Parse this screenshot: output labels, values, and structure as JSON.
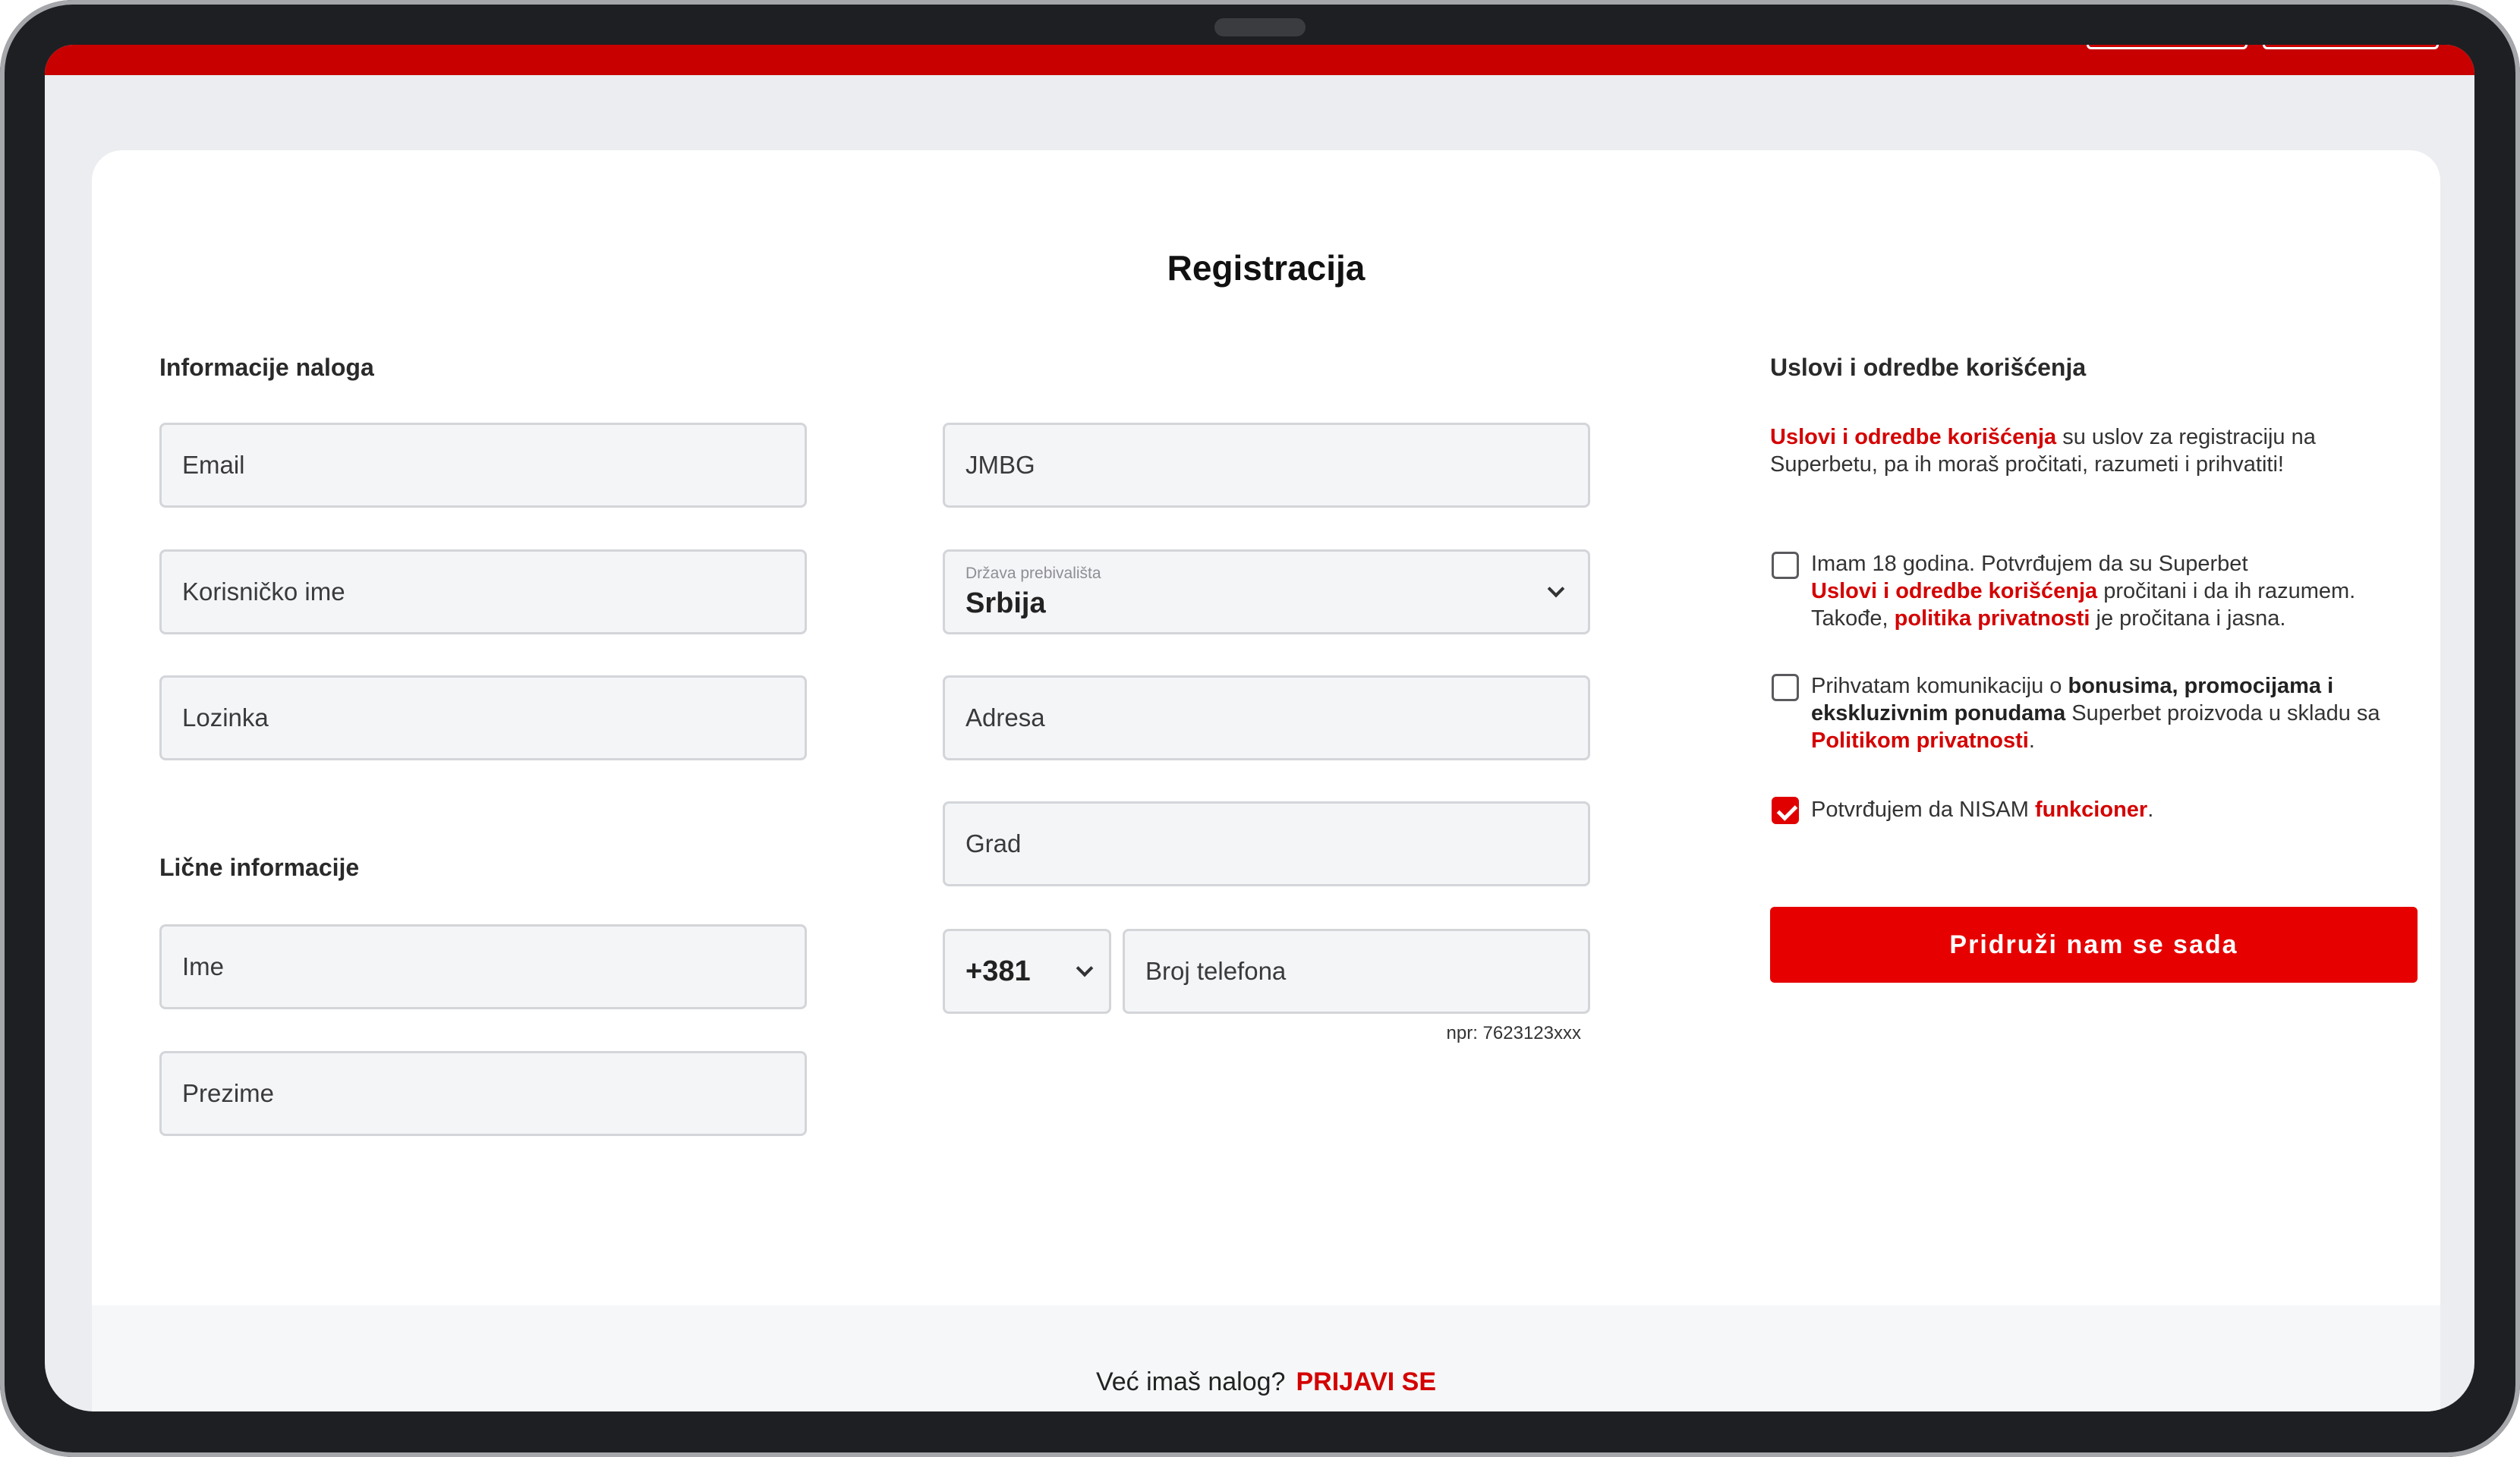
{
  "page": {
    "title": "Registracija"
  },
  "account_section": {
    "label": "Informacije naloga",
    "email_placeholder": "Email",
    "username_placeholder": "Korisničko ime",
    "password_placeholder": "Lozinka"
  },
  "personal_section": {
    "label": "Lične informacije",
    "first_name_placeholder": "Ime",
    "last_name_placeholder": "Prezime"
  },
  "middle_column": {
    "jmbg_placeholder": "JMBG",
    "country_label": "Država prebivališta",
    "country_value": "Srbija",
    "address_placeholder": "Adresa",
    "city_placeholder": "Grad",
    "phone_prefix": "+381",
    "phone_placeholder": "Broj telefona",
    "phone_hint": "npr: 7623123xxx"
  },
  "terms": {
    "heading": "Uslovi i odredbe korišćenja",
    "intro_link": "Uslovi i odredbe korišćenja",
    "intro_rest": " su uslov za registraciju na Superbetu, pa ih moraš pročitati, razumeti i prihvatiti!",
    "check1": {
      "checked": false,
      "text_a": "Imam 18 godina. Potvrđujem da su Superbet",
      "link_a": "Uslovi i odredbe korišćenja",
      "text_b": " pročitani i da ih razumem.",
      "text_c": "Takođe, ",
      "link_b": "politika privatnosti",
      "text_d": " je pročitana i jasna."
    },
    "check2": {
      "checked": false,
      "text_a": "Prihvatam komunikaciju o ",
      "bold_a": "bonusima, promocijama i ekskluzivnim ponudama",
      "text_b": " Superbet proizvoda u skladu sa ",
      "link_a": "Politikom privatnosti",
      "text_c": "."
    },
    "check3": {
      "checked": true,
      "text_a": "Potvrđujem da NISAM ",
      "link_a": "funkcioner",
      "text_b": "."
    },
    "join_button": "Pridruži nam se sada"
  },
  "footer": {
    "question": "Već imaš nalog?",
    "login_link": "PRIJAVI SE"
  },
  "colors": {
    "brand_red": "#e60000",
    "topbar_red": "#c80000",
    "link_red": "#d40000"
  }
}
